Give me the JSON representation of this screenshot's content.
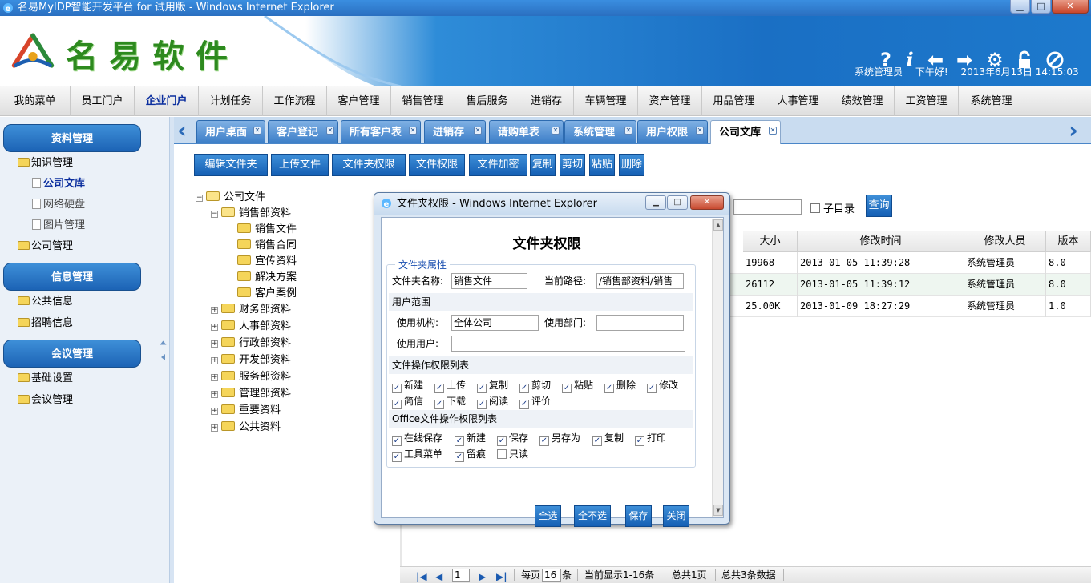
{
  "window": {
    "title": "名易MyIDP智能开发平台 for 试用版 - Windows Internet Explorer"
  },
  "header": {
    "logo_text": "名易软件",
    "user": "系统管理员",
    "greeting": "下午好!",
    "datetime": "2013年6月13日  14:15:03"
  },
  "mainnav": [
    "我的菜单",
    "员工门户",
    "企业门户",
    "计划任务",
    "工作流程",
    "客户管理",
    "销售管理",
    "售后服务",
    "进销存",
    "车辆管理",
    "资产管理",
    "用品管理",
    "人事管理",
    "绩效管理",
    "工资管理",
    "系统管理"
  ],
  "sidebar": {
    "sections": [
      "资料管理",
      "信息管理",
      "会议管理"
    ],
    "items": [
      "知识管理",
      "公司文库",
      "网络硬盘",
      "图片管理",
      "公司管理",
      "公共信息",
      "招聘信息",
      "基础设置",
      "会议管理"
    ]
  },
  "tabs": [
    "用户桌面",
    "客户登记",
    "所有客户表",
    "进销存",
    "请购单表",
    "系统管理",
    "用户权限",
    "公司文库"
  ],
  "toolbar": [
    "编辑文件夹",
    "上传文件",
    "文件夹权限",
    "文件权限",
    "文件加密",
    "复制",
    "剪切",
    "粘贴",
    "删除"
  ],
  "tree": {
    "root": "公司文件",
    "open": "销售部资料",
    "children": [
      "销售文件",
      "销售合同",
      "宣传资料",
      "解决方案",
      "客户案例"
    ],
    "others": [
      "财务部资料",
      "人事部资料",
      "行政部资料",
      "开发部资料",
      "服务部资料",
      "管理部资料",
      "重要资料",
      "公共资料"
    ]
  },
  "search": {
    "subdir": "子目录",
    "query": "查询"
  },
  "grid": {
    "columns": [
      "大小",
      "修改时间",
      "修改人员",
      "版本"
    ],
    "rows": [
      [
        "19968",
        "2013-01-05 11:39:28",
        "系统管理员",
        "8.0"
      ],
      [
        "26112",
        "2013-01-05 11:39:12",
        "系统管理员",
        "8.0"
      ],
      [
        "25.00K",
        "2013-01-09 18:27:29",
        "系统管理员",
        "1.0"
      ]
    ]
  },
  "pager": {
    "page": "1",
    "per_page_label": "每页",
    "per_page": "16",
    "per_page_unit": "条",
    "showing": "当前显示1-16条",
    "total_pages": "总共1页",
    "total_records": "总共3条数据"
  },
  "dialog": {
    "title": "文件夹权限 - Windows Internet Explorer",
    "heading": "文件夹权限",
    "legend": "文件夹属性",
    "name_label": "文件夹名称:",
    "name_value": "销售文件",
    "path_label": "当前路径:",
    "path_value": "/销售部资料/销售",
    "scope_label": "用户范围",
    "org_label": "使用机构:",
    "org_value": "全体公司",
    "dept_label": "使用部门:",
    "dept_value": "",
    "user_label": "使用用户:",
    "user_value": "",
    "file_ops_label": "文件操作权限列表",
    "file_ops": [
      {
        "label": "新建",
        "checked": true
      },
      {
        "label": "上传",
        "checked": true
      },
      {
        "label": "复制",
        "checked": true
      },
      {
        "label": "剪切",
        "checked": true
      },
      {
        "label": "粘贴",
        "checked": true
      },
      {
        "label": "删除",
        "checked": true
      },
      {
        "label": "修改",
        "checked": true
      },
      {
        "label": "简信",
        "checked": true
      },
      {
        "label": "下载",
        "checked": true
      },
      {
        "label": "阅读",
        "checked": true
      },
      {
        "label": "评价",
        "checked": true
      }
    ],
    "office_ops_label": "Office文件操作权限列表",
    "office_ops": [
      {
        "label": "在线保存",
        "checked": true
      },
      {
        "label": "新建",
        "checked": true
      },
      {
        "label": "保存",
        "checked": true
      },
      {
        "label": "另存为",
        "checked": true
      },
      {
        "label": "复制",
        "checked": true
      },
      {
        "label": "打印",
        "checked": true
      },
      {
        "label": "工具菜单",
        "checked": true
      },
      {
        "label": "留痕",
        "checked": true
      },
      {
        "label": "只读",
        "checked": false
      }
    ],
    "buttons": [
      "全选",
      "全不选",
      "保存",
      "关闭"
    ]
  }
}
